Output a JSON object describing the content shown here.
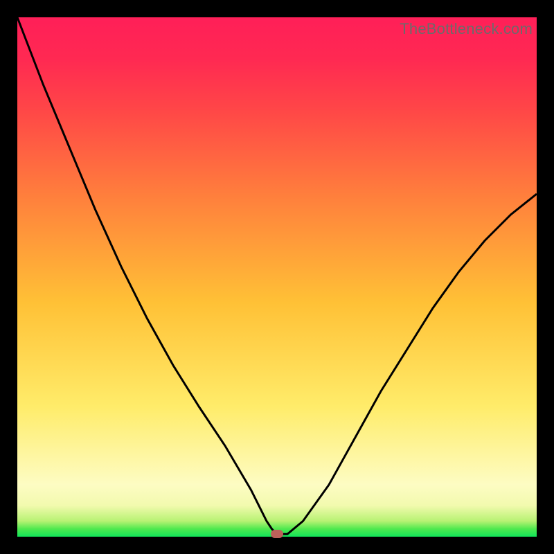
{
  "watermark": "TheBottleneck.com",
  "colors": {
    "frame": "#000000",
    "curve": "#000000",
    "marker": "#bd615a",
    "gradient_top": "#ff1f58",
    "gradient_bottom": "#11e55a"
  },
  "chart_data": {
    "type": "line",
    "title": "",
    "xlabel": "",
    "ylabel": "",
    "xlim": [
      0,
      100
    ],
    "ylim": [
      0,
      100
    ],
    "grid": false,
    "legend": false,
    "x": [
      0,
      5,
      10,
      15,
      20,
      25,
      30,
      35,
      40,
      45,
      48,
      49,
      50,
      52,
      55,
      60,
      65,
      70,
      75,
      80,
      85,
      90,
      95,
      100
    ],
    "values": [
      100,
      87,
      75,
      63,
      52,
      42,
      33,
      25,
      17.5,
      9,
      3,
      1.5,
      0.5,
      0.5,
      3,
      10,
      19,
      28,
      36,
      44,
      51,
      57,
      62,
      66
    ],
    "marker": {
      "x": 50,
      "y": 0
    }
  }
}
